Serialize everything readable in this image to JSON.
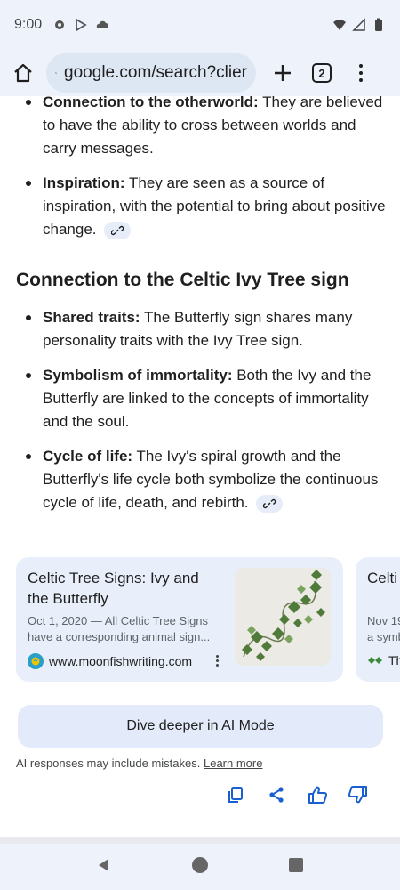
{
  "status_bar": {
    "time": "9:00"
  },
  "browser": {
    "url": "google.com/search?clier",
    "tab_count": "2"
  },
  "content": {
    "bullets_top": [
      {
        "title": "Connection to the otherworld:",
        "text": " They are believed to have the ability to cross between worlds and carry messages."
      },
      {
        "title": "Inspiration:",
        "text": " They are seen as a source of inspiration, with the potential to bring about positive change."
      }
    ],
    "heading": "Connection to the Celtic Ivy Tree sign",
    "bullets_bottom": [
      {
        "title": "Shared traits:",
        "text": " The Butterfly sign shares many personality traits with the Ivy Tree sign."
      },
      {
        "title": "Symbolism of immortality:",
        "text": " Both the Ivy and the Butterfly are linked to the concepts of immortality and the soul."
      },
      {
        "title": "Cycle of life:",
        "text": " The Ivy's spiral growth and the Butterfly's life cycle both symbolize the continuous cycle of life, death, and rebirth."
      }
    ]
  },
  "cards": [
    {
      "title": "Celtic Tree Signs: Ivy and the Butterfly",
      "snippet": "Oct 1, 2020 — All Celtic Tree Signs have a corresponding animal sign...",
      "source": "www.moonfishwriting.com"
    },
    {
      "title": "Celti",
      "snippet": "Nov 19",
      "snippet2": "a symb",
      "source": "Th"
    }
  ],
  "dive_deeper": "Dive deeper in AI Mode",
  "disclaimer": {
    "text": "AI responses may include mistakes. ",
    "link": "Learn more"
  },
  "colors": {
    "accent": "#1a5fd0",
    "background": "#ffffff",
    "chip": "#e6edf9"
  }
}
